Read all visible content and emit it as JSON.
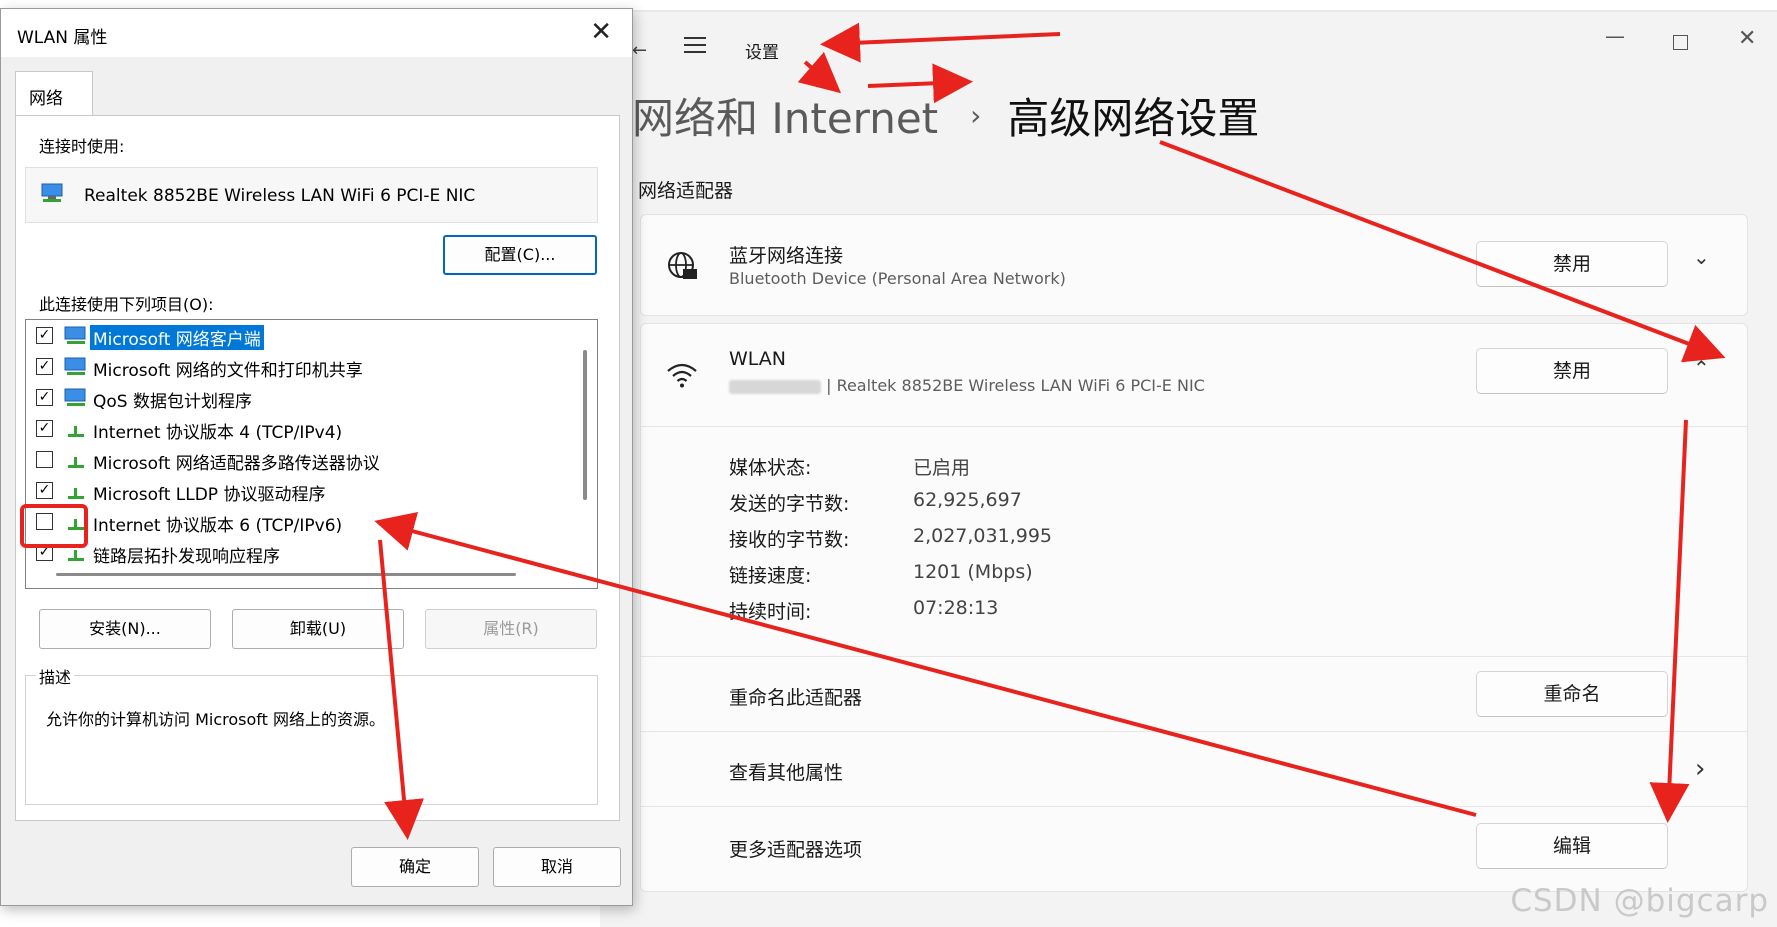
{
  "settings": {
    "back_icon": "←",
    "menu_icon": "hamburger-icon",
    "title": "设置",
    "window_controls": {
      "minimize": "—",
      "close": "✕"
    },
    "breadcrumb": {
      "parent": "网络和 Internet",
      "separator": "›",
      "current": "高级网络设置"
    },
    "section_label": "网络适配器",
    "adapters": [
      {
        "name": "蓝牙网络连接",
        "subtitle": "Bluetooth Device (Personal Area Network)",
        "button": "禁用",
        "chevron": "⌄"
      },
      {
        "name": "WLAN",
        "subtitle": " | Realtek 8852BE Wireless LAN WiFi 6 PCI-E NIC",
        "button": "禁用",
        "chevron": "⌃"
      }
    ],
    "wlan_properties": [
      {
        "label": "媒体状态:",
        "value": "已启用"
      },
      {
        "label": "发送的字节数:",
        "value": "62,925,697"
      },
      {
        "label": "接收的字节数:",
        "value": "2,027,031,995"
      },
      {
        "label": "链接速度:",
        "value": "1201 (Mbps)"
      },
      {
        "label": "持续时间:",
        "value": "07:28:13"
      }
    ],
    "options": {
      "rename_label": "重命名此适配器",
      "rename_button": "重命名",
      "more_props_label": "查看其他属性",
      "more_props_chevron": "›",
      "more_options_label": "更多适配器选项",
      "edit_button": "编辑"
    }
  },
  "dialog": {
    "title": "WLAN 属性",
    "close": "✕",
    "tab": "网络",
    "connect_using_label": "连接时使用:",
    "nic_name": "Realtek 8852BE Wireless LAN WiFi 6 PCI-E NIC",
    "configure_button": "配置(C)...",
    "items_label": "此连接使用下列项目(O):",
    "items": [
      {
        "label": "Microsoft 网络客户端",
        "checked": "✓",
        "icon": "network-client-icon"
      },
      {
        "label": "Microsoft 网络的文件和打印机共享",
        "checked": "✓",
        "icon": "network-client-icon"
      },
      {
        "label": "QoS 数据包计划程序",
        "checked": "✓",
        "icon": "network-client-icon"
      },
      {
        "label": "Internet 协议版本 4 (TCP/IPv4)",
        "checked": "✓",
        "icon": "protocol-icon"
      },
      {
        "label": "Microsoft 网络适配器多路传送器协议",
        "checked": "",
        "icon": "protocol-icon"
      },
      {
        "label": "Microsoft LLDP 协议驱动程序",
        "checked": "✓",
        "icon": "protocol-icon"
      },
      {
        "label": "Internet 协议版本 6 (TCP/IPv6)",
        "checked": "",
        "icon": "protocol-icon"
      },
      {
        "label": "链路层拓扑发现响应程序",
        "checked": "✓",
        "icon": "protocol-icon"
      }
    ],
    "install_button": "安装(N)...",
    "uninstall_button": "卸载(U)",
    "properties_button": "属性(R)",
    "description_legend": "描述",
    "description_text": "允许你的计算机访问 Microsoft 网络上的资源。",
    "ok_button": "确定",
    "cancel_button": "取消"
  },
  "watermark": "CSDN @bigcarp",
  "colors": {
    "annotation": "#e8231d",
    "selection": "#0078d7",
    "primary_border": "#0067c0"
  }
}
